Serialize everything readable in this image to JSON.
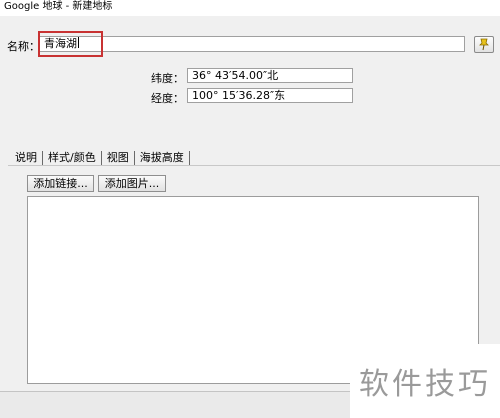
{
  "window": {
    "title": "Google 地球 - 新建地标"
  },
  "name": {
    "label": "名称：",
    "value": "青海湖"
  },
  "pin_icon": "pushpin-icon",
  "coordinates": {
    "latitude_label": "纬度：",
    "latitude_value": "36° 43′54.00″北",
    "longitude_label": "经度：",
    "longitude_value": "100° 15′36.28″东"
  },
  "tabs": [
    {
      "label": "说明"
    },
    {
      "label": "样式/颜色"
    },
    {
      "label": "视图"
    },
    {
      "label": "海拔高度"
    }
  ],
  "buttons": {
    "add_link": "添加链接...",
    "add_image": "添加图片..."
  },
  "description": {
    "value": ""
  },
  "watermark": {
    "text": "软件技巧"
  },
  "colors": {
    "highlight": "#c83232",
    "pin": "#e8c21a"
  }
}
